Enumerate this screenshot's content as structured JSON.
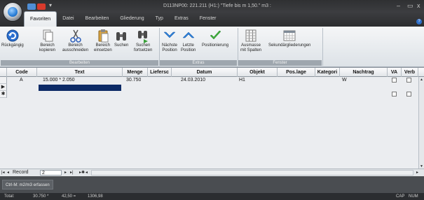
{
  "window": {
    "title": "D113NP00: 221.211   (H1:) \"Tiefe bis m 1,50.\" m3 :",
    "min_glyph": "–",
    "max_glyph": "▭",
    "close_glyph": "x",
    "qat_menu_glyph": "▾"
  },
  "tabs": [
    "Favoriten",
    "Datei",
    "Bearbeiten",
    "Gliederung",
    "Typ",
    "Extras",
    "Fenster"
  ],
  "help_glyph": "?",
  "ribbon": {
    "buttons": {
      "undo": "Rückgängig",
      "copy_line1": "Bereich",
      "copy_line2": "kopieren",
      "cut_line1": "Bereich",
      "cut_line2": "ausschneiden",
      "paste_line1": "Bereich",
      "paste_line2": "einsetzen",
      "find": "Suchen",
      "findnext_line1": "Suchen",
      "findnext_line2": "fortsetzen",
      "next_line1": "Nächste",
      "next_line2": "Position",
      "last_line1": "Letzte",
      "last_line2": "Position",
      "positioning": "Positionierung",
      "ausmasse_line1": "Ausmasse",
      "ausmasse_line2": "mit Spalten",
      "sekundar": "Sekundärgliederungen"
    },
    "groups": {
      "bearbeiten": "Bearbeiten",
      "extras": "Extras",
      "fenster": "Fenster"
    }
  },
  "grid": {
    "columns": [
      "Code",
      "Text",
      "Menge",
      "Liefersc",
      "Datum",
      "Objekt",
      "Pos.lage",
      "Kategori",
      "Nachtrag",
      "VA",
      "Verb"
    ],
    "rows": [
      {
        "code": "A",
        "text": "15.000 *  2.050",
        "menge": "30.750",
        "liefersc": "",
        "datum": "24.03.2010",
        "objekt": "H1",
        "poslage": "",
        "kategori": "",
        "nachtrag": "W",
        "va": false,
        "verb": false
      }
    ],
    "current_row_marker": "▶",
    "new_row_marker": "✱"
  },
  "navigator": {
    "record_label": "Record",
    "record_value": "2",
    "first": "|◂",
    "prev": "◂",
    "next": "▸",
    "next_new": "▸|",
    "last": "▸✱",
    "hscroll_left": "◂",
    "hscroll_right": "▸"
  },
  "hint": "Ctrl-M: m2/m3 erfassen",
  "status": {
    "total_label": "Total:",
    "total_value": "30.750 *",
    "m2_value": "42,50 =",
    "m3_value": "1306,98",
    "caps": "CAP",
    "num": "NUM"
  },
  "colors": {
    "title_bar": "#2f3032",
    "ribbon": "#e4e8ec",
    "edit_highlight": "#0c2a66",
    "accent_blue": "#2a7fd8"
  }
}
